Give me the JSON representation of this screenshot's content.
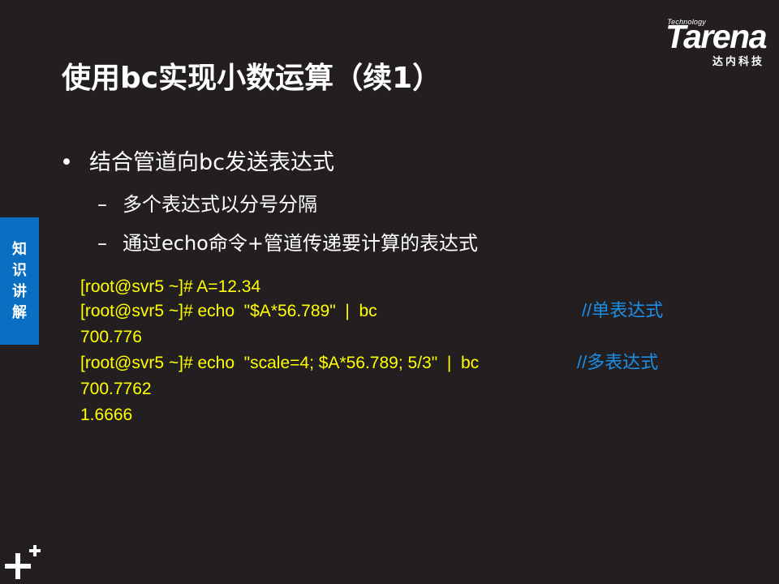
{
  "logo": {
    "tagline": "Technology",
    "wordmark": "Tarena",
    "subtitle": "达内科技"
  },
  "slide": {
    "title": "使用bc实现小数运算（续1）",
    "bullet_main": "结合管道向bc发送表达式",
    "bullet_sub": [
      "多个表达式以分号分隔",
      "通过echo命令+管道传递要计算的表达式"
    ],
    "bullet_marker": "•",
    "dash_marker": "–"
  },
  "sidebar": {
    "chars": [
      "知",
      "识",
      "讲",
      "解"
    ]
  },
  "code": {
    "lines": [
      "[root@svr5 ~]# A=12.34",
      "[root@svr5 ~]# echo  \"$A*56.789\"  |  bc",
      "700.776",
      "[root@svr5 ~]# echo  \"scale=4; $A*56.789; 5/3\"  |  bc",
      "700.7762",
      "1.6666"
    ],
    "comments": [
      "//单表达式",
      "//多表达式"
    ]
  },
  "colors": {
    "background": "#231f20",
    "code_text": "#ffff00",
    "comment_text": "#1b8ee6",
    "sidebar_tab": "#0a6fc2"
  },
  "icons": {
    "corner": "plus-plus-icon"
  }
}
